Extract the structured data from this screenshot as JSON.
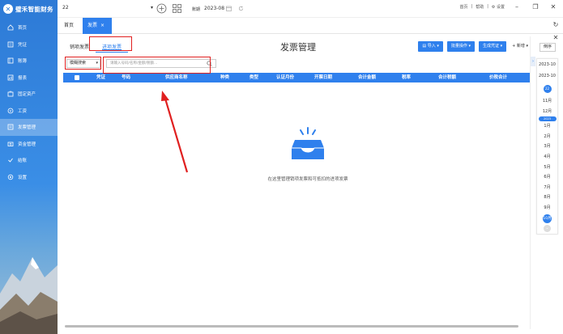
{
  "app": {
    "logo_text": "璧禾智能财务",
    "company": "22"
  },
  "topbar": {
    "period_label": "账期",
    "period_value": "2023-08",
    "links": [
      "首页",
      "帮助",
      "设置"
    ]
  },
  "sidebar": {
    "items": [
      {
        "label": "首页",
        "icon": "home-icon"
      },
      {
        "label": "凭证",
        "icon": "voucher-icon"
      },
      {
        "label": "账簿",
        "icon": "ledger-icon"
      },
      {
        "label": "报表",
        "icon": "report-icon"
      },
      {
        "label": "固定资产",
        "icon": "asset-icon"
      },
      {
        "label": "工资",
        "icon": "salary-icon"
      },
      {
        "label": "发票管理",
        "icon": "invoice-icon",
        "active": true
      },
      {
        "label": "资金管理",
        "icon": "fund-icon"
      },
      {
        "label": "结账",
        "icon": "close-account-icon"
      },
      {
        "label": "设置",
        "icon": "settings-icon"
      }
    ]
  },
  "tabs": {
    "home": "首页",
    "invoice": "发票",
    "close": "×"
  },
  "sub_tabs": {
    "sales": "销项发票",
    "purchase": "进项发票"
  },
  "page_title": "发票管理",
  "toolbar": {
    "import": "导入",
    "batch": "批量操作",
    "voucher": "生成凭证",
    "add": "+ 新增"
  },
  "search": {
    "filter_label": "模糊搜索",
    "placeholder": "请输入号码/名称/金额/税额..."
  },
  "table": {
    "columns": [
      "凭证",
      "号码",
      "供应商名称",
      "种类",
      "类型",
      "认证月份",
      "开票日期",
      "合计金额",
      "税率",
      "合计税额",
      "价税合计"
    ]
  },
  "empty_text": "在这里管理销项发票和可抵扣的进项发票",
  "period_panel": {
    "sort_label": "倒序",
    "range_start": "2023-10",
    "range_end": "2023-10",
    "year_small": "22",
    "year_pill": "2023",
    "months": [
      "11月",
      "12月",
      "1月",
      "2月",
      "3月",
      "4月",
      "5月",
      "6月",
      "7月",
      "8月",
      "9月"
    ],
    "current_month": "10月"
  },
  "colors": {
    "primary": "#2f80ed",
    "highlight": "#e02020"
  }
}
